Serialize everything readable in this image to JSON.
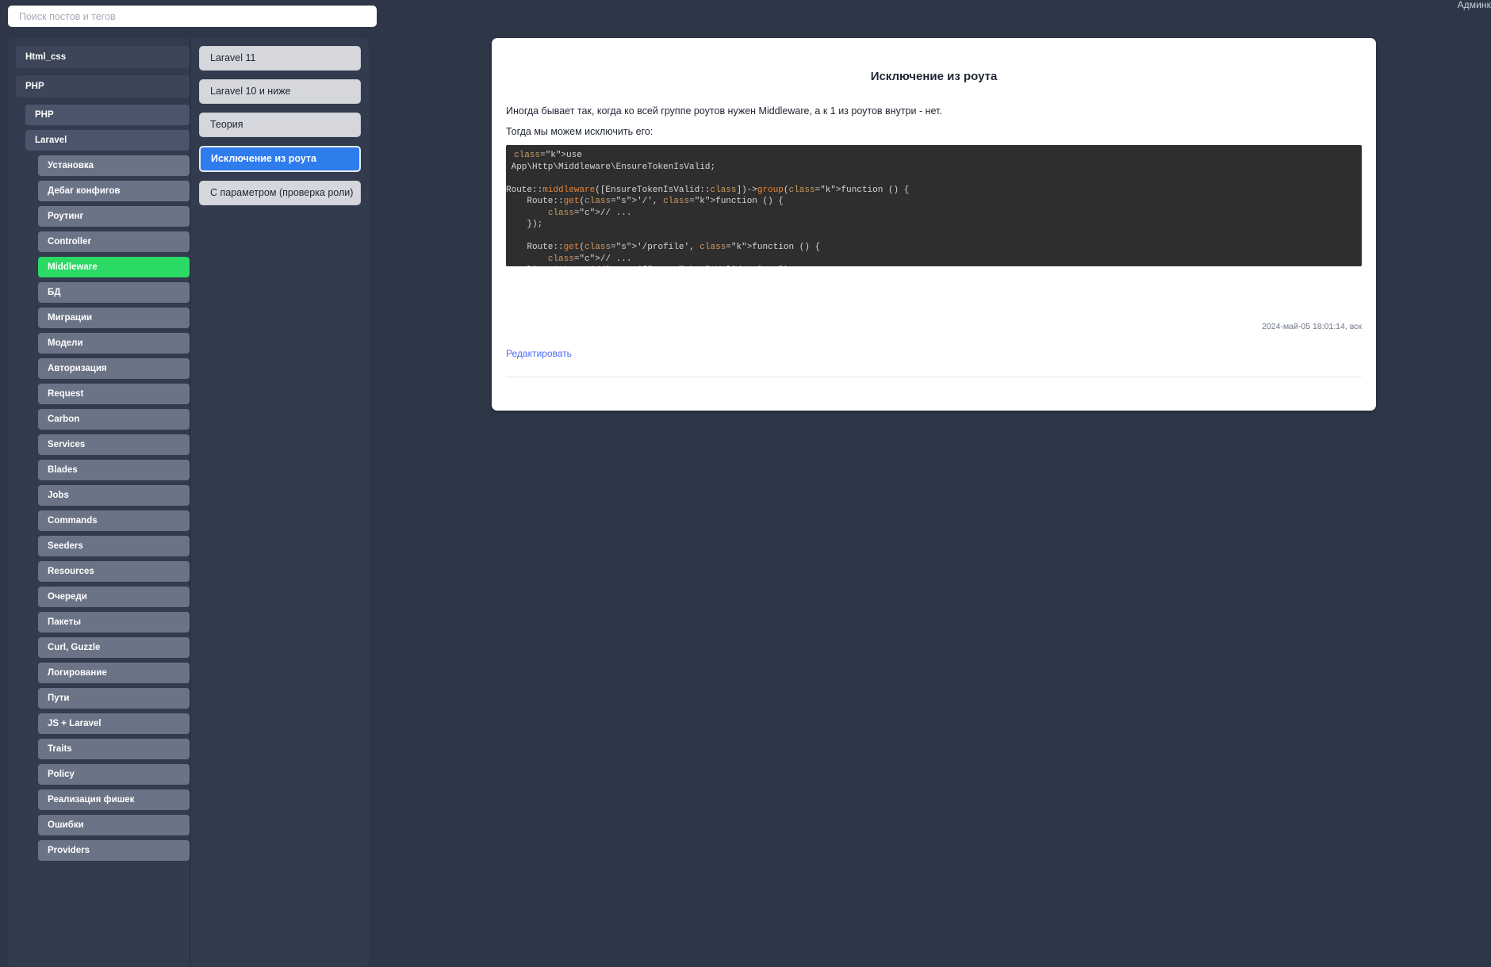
{
  "topbar": {
    "admin_label": "Админк"
  },
  "search": {
    "value": "",
    "placeholder": "Поиск постов и тегов"
  },
  "sidebar": {
    "items": [
      {
        "label": "Html_css",
        "level": 0,
        "active": false
      },
      {
        "label": "PHP",
        "level": 0,
        "active": false
      },
      {
        "label": "PHP",
        "level": 1,
        "active": false
      },
      {
        "label": "Laravel",
        "level": 1,
        "active": false
      },
      {
        "label": "Установка",
        "level": 2,
        "active": false
      },
      {
        "label": "Дебаг конфигов",
        "level": 2,
        "active": false
      },
      {
        "label": "Роутинг",
        "level": 2,
        "active": false
      },
      {
        "label": "Controller",
        "level": 2,
        "active": false
      },
      {
        "label": "Middleware",
        "level": 2,
        "active": true
      },
      {
        "label": "БД",
        "level": 2,
        "active": false
      },
      {
        "label": "Миграции",
        "level": 2,
        "active": false
      },
      {
        "label": "Модели",
        "level": 2,
        "active": false
      },
      {
        "label": "Авторизация",
        "level": 2,
        "active": false
      },
      {
        "label": "Request",
        "level": 2,
        "active": false
      },
      {
        "label": "Carbon",
        "level": 2,
        "active": false
      },
      {
        "label": "Services",
        "level": 2,
        "active": false
      },
      {
        "label": "Blades",
        "level": 2,
        "active": false
      },
      {
        "label": "Jobs",
        "level": 2,
        "active": false
      },
      {
        "label": "Commands",
        "level": 2,
        "active": false
      },
      {
        "label": "Seeders",
        "level": 2,
        "active": false
      },
      {
        "label": "Resources",
        "level": 2,
        "active": false
      },
      {
        "label": "Очереди",
        "level": 2,
        "active": false
      },
      {
        "label": "Пакеты",
        "level": 2,
        "active": false
      },
      {
        "label": "Curl, Guzzle",
        "level": 2,
        "active": false
      },
      {
        "label": "Логирование",
        "level": 2,
        "active": false
      },
      {
        "label": "Пути",
        "level": 2,
        "active": false
      },
      {
        "label": "JS + Laravel",
        "level": 2,
        "active": false
      },
      {
        "label": "Traits",
        "level": 2,
        "active": false
      },
      {
        "label": "Policy",
        "level": 2,
        "active": false
      },
      {
        "label": "Реализация фишек",
        "level": 2,
        "active": false
      },
      {
        "label": "Ошибки",
        "level": 2,
        "active": false
      },
      {
        "label": "Providers",
        "level": 2,
        "active": false
      }
    ]
  },
  "postlist": {
    "items": [
      {
        "label": "Laravel 11",
        "selected": false
      },
      {
        "label": "Laravel 10 и ниже",
        "selected": false
      },
      {
        "label": "Теория",
        "selected": false
      },
      {
        "label": "Исключение из роута",
        "selected": true
      },
      {
        "label": "С параметром (проверка роли)",
        "selected": false
      }
    ]
  },
  "article": {
    "title": "Исключение из роута",
    "paragraph1": "Иногда бывает так, когда ко всей группе роутов нужен Middleware, а к 1 из роутов внутри - нет.",
    "paragraph2": "Тогда мы можем исключить его:",
    "code": "use App\\Http\\Middleware\\EnsureTokenIsValid;\n\nRoute::middleware([EnsureTokenIsValid::class])->group(function () {\n    Route::get('/', function () {\n        // ...\n    });\n\n    Route::get('/profile', function () {\n        // ...\n    })->withoutMiddleware([EnsureTokenIsValid::class]);\n});",
    "date": "2024-май-05 18:01:14, вск",
    "edit_label": "Редактировать"
  },
  "colors": {
    "page_bg": "#2e3747",
    "panel_bg": "#323c4e",
    "accent_green": "#2bd965",
    "accent_blue": "#2f7ced",
    "link_blue": "#4a6cf7",
    "code_bg": "#2e2e2e"
  }
}
